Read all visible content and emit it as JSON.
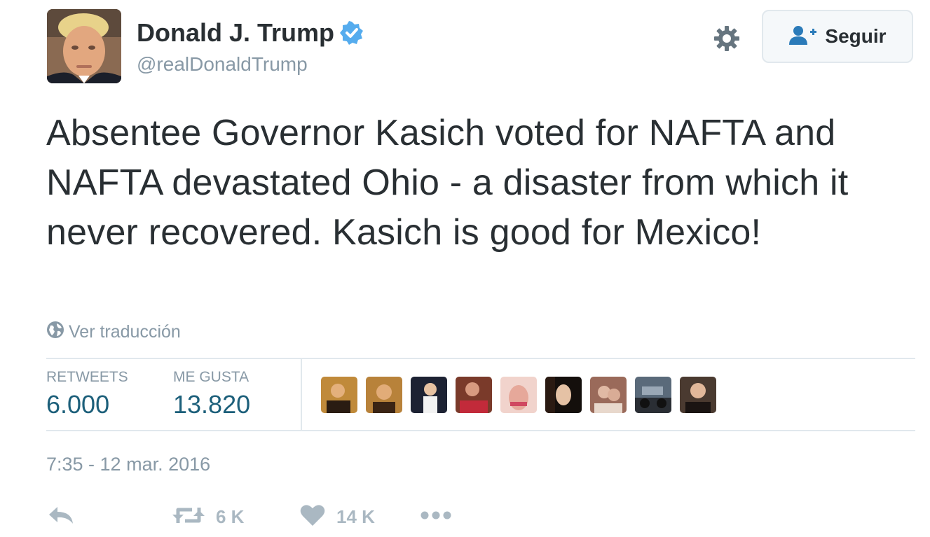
{
  "user": {
    "display_name": "Donald J. Trump",
    "handle": "@realDonaldTrump",
    "verified": true,
    "avatar_icon": "profile-photo"
  },
  "header": {
    "settings_icon": "gear-icon",
    "follow_label": "Seguir",
    "follow_icon": "add-user-icon"
  },
  "tweet": {
    "text": "Absentee Governor Kasich voted for NAFTA and NAFTA devastated Ohio - a disaster from which it never recovered. Kasich is good for Mexico!",
    "translate_label": "Ver traducción",
    "translate_icon": "globe-icon"
  },
  "stats": {
    "retweets_label": "RETWEETS",
    "retweets_value": "6.000",
    "likes_label": "ME GUSTA",
    "likes_value": "13.820",
    "liker_avatars": [
      "avatar-1",
      "avatar-2",
      "avatar-3",
      "avatar-4",
      "avatar-5",
      "avatar-6",
      "avatar-7",
      "avatar-8",
      "avatar-9"
    ]
  },
  "timestamp": "7:35 - 12 mar. 2016",
  "actions": {
    "reply_icon": "reply-icon",
    "retweet_icon": "retweet-icon",
    "retweet_count": "6 K",
    "like_icon": "heart-icon",
    "like_count": "14 K",
    "more_icon": "more-dots-icon"
  },
  "colors": {
    "text": "#292f33",
    "muted": "#8899a6",
    "count_blue": "#1c5f7a",
    "verified_blue": "#55acee",
    "action_grey": "#aab8c2",
    "divider": "#e1e8ed"
  }
}
